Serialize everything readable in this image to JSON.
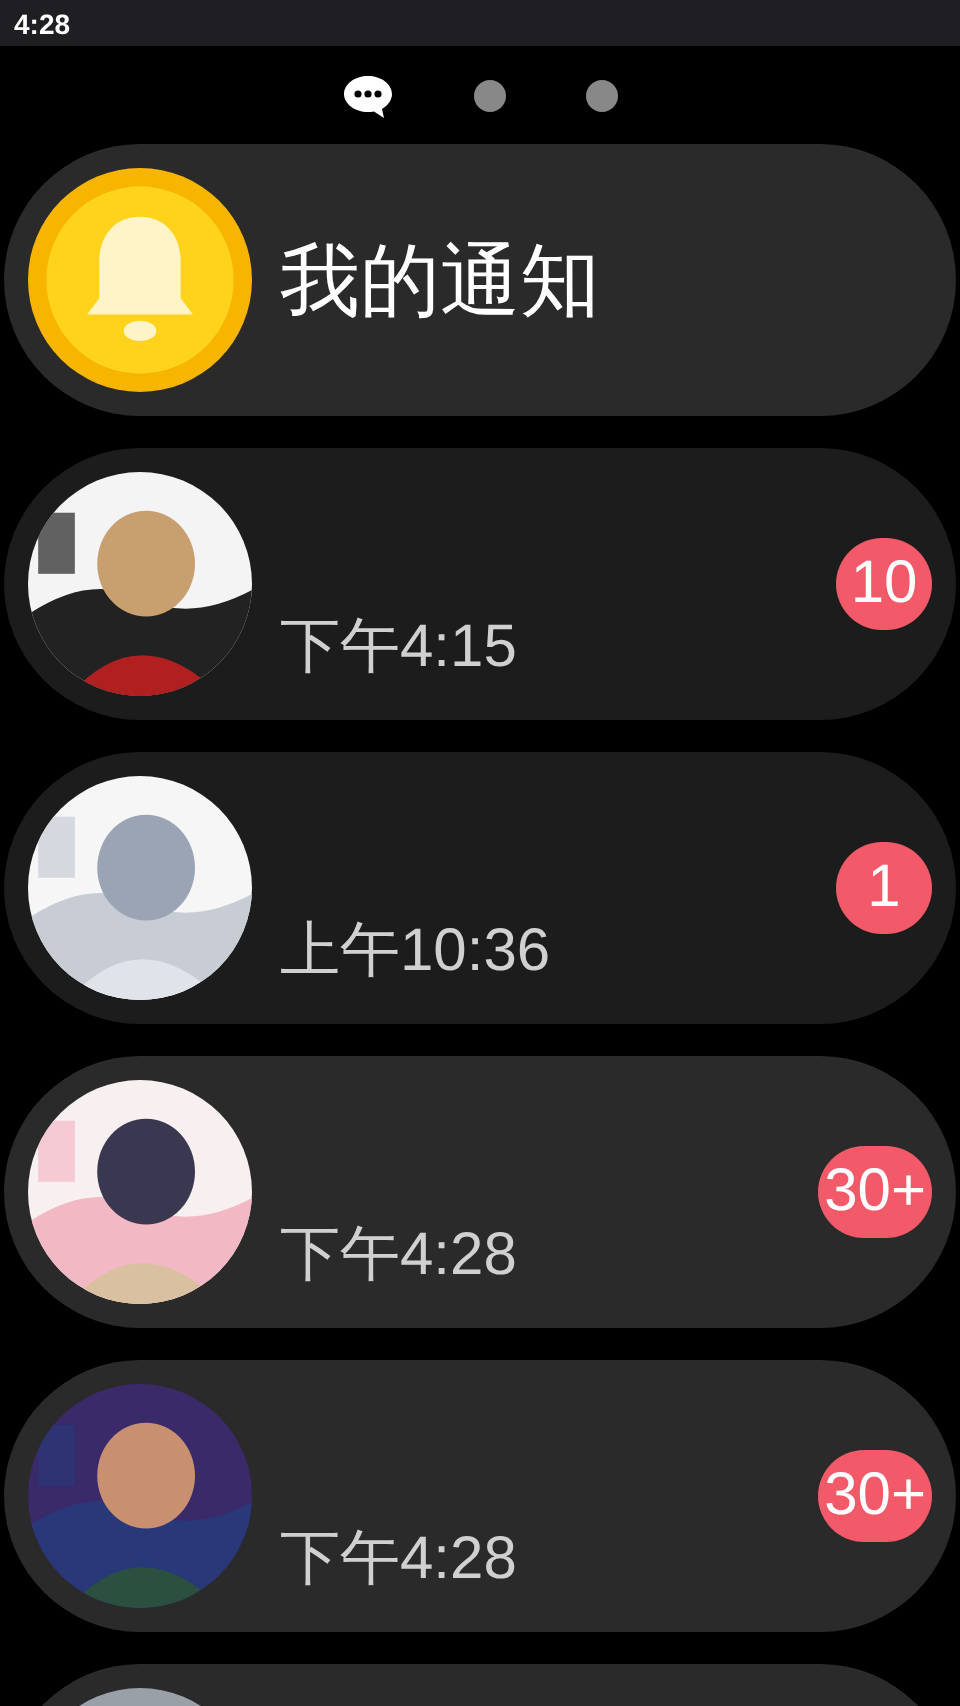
{
  "status_bar": {
    "time": "4:28"
  },
  "pager": [
    {
      "kind": "chat",
      "selected": true
    },
    {
      "kind": "dot",
      "selected": false
    },
    {
      "kind": "dot",
      "selected": false
    }
  ],
  "header_card": {
    "title": "我的通知"
  },
  "chats": [
    {
      "time": "下午4:15",
      "badge": "10",
      "highlighted": true
    },
    {
      "time": "上午10:36",
      "badge": "1",
      "highlighted": true
    },
    {
      "time": "下午4:28",
      "badge": "30+",
      "highlighted": false
    },
    {
      "time": "下午4:28",
      "badge": "30+",
      "highlighted": false
    },
    {
      "highlighted": false
    }
  ]
}
